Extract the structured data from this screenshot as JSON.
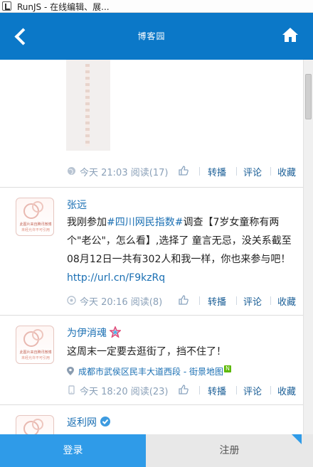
{
  "window": {
    "title": "RunJS - 在线编辑、展..."
  },
  "header": {
    "title": "博客园",
    "back_icon": "back-arrow-icon",
    "home_icon": "home-icon",
    "color": "#0b78c8"
  },
  "posts": [
    {
      "meta": {
        "time": "今天 21:03",
        "read": "阅读(17)",
        "repost": "转播",
        "comment": "评论",
        "favorite": "收藏"
      }
    },
    {
      "author": "张远",
      "avatar_lines": [
        "此图片来自腾讯微博",
        "未经允许不可引用"
      ],
      "text_parts": [
        "我刚参加",
        "#四川网民指数#",
        "调查【7岁女童称有两个\"老公\"，怎么看】,选择了 童言无忌，没关系截至08月12日一共有302人和我一样，你也来参与吧！",
        "http://url.cn/F9kzRq"
      ],
      "meta": {
        "time": "今天 20:16",
        "read": "阅读(8)",
        "repost": "转播",
        "comment": "评论",
        "favorite": "收藏"
      }
    },
    {
      "author": "为伊消魂",
      "avatar_lines": [
        "此图片来自腾讯微博",
        "未经允许不可引用"
      ],
      "text": "这周末一定要去逛街了，挡不住了！",
      "location": "成都市武侯区民丰大道西段 - 街景地图",
      "location_badge": "N",
      "meta": {
        "time": "今天 18:20",
        "read": "阅读(23)",
        "repost": "转播",
        "comment": "评论",
        "favorite": "收藏"
      }
    },
    {
      "author": "返利网"
    }
  ],
  "bottom_bar": {
    "login": "登录",
    "register": "注册"
  }
}
